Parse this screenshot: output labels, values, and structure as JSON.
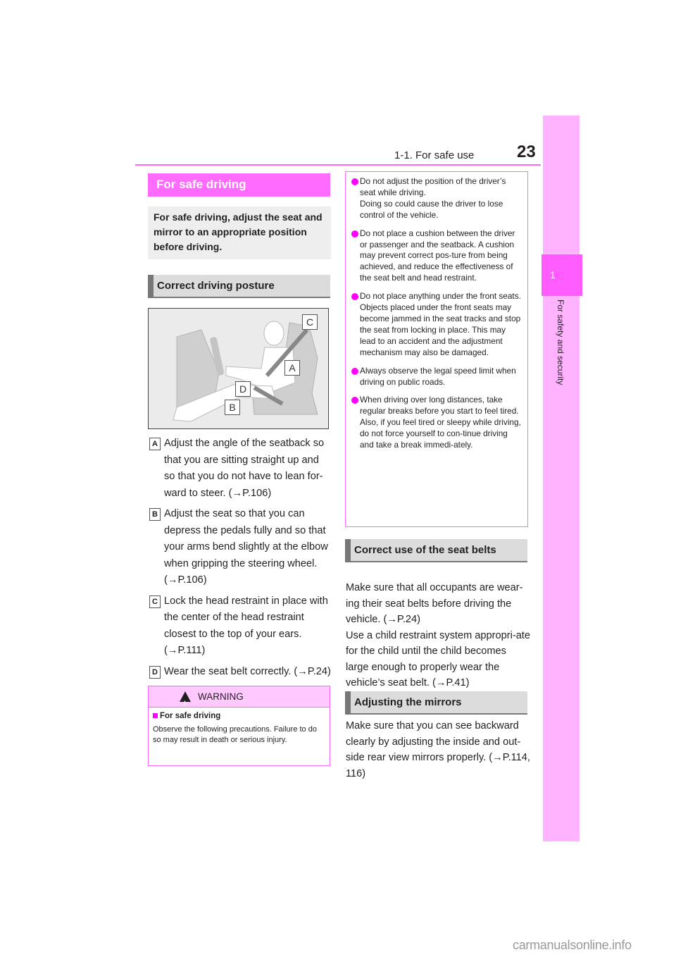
{
  "header": {
    "section": "1-1. For safe use",
    "page_number": "23"
  },
  "side_tab": {
    "chapter_number": "1",
    "chapter_title": "For safety and security"
  },
  "title": "For safe driving",
  "intro": "For safe driving, adjust the seat and mirror to an appropriate position before driving.",
  "posture": {
    "heading": "Correct driving posture",
    "figure_callouts": [
      "C",
      "A",
      "D",
      "B"
    ],
    "steps": [
      {
        "label": "A",
        "text": "Adjust the angle of the seatback so that you are sitting straight up and so that you do not have to lean for-ward to steer. (→P.106)"
      },
      {
        "label": "B",
        "text": "Adjust the seat so that you can depress the pedals fully and so that your arms bend slightly at the elbow when gripping the steering wheel. (→P.106)"
      },
      {
        "label": "C",
        "text": "Lock the head restraint in place with the center of the head restraint closest to the top of your ears. (→P.111)"
      },
      {
        "label": "D",
        "text": "Wear the seat belt correctly. (→P.24)"
      }
    ]
  },
  "warning": {
    "heading": "WARNING",
    "subheading": "For safe driving",
    "text": "Observe the following precautions. Failure to do so may result in death or serious injury.",
    "bullets": [
      {
        "lines": [
          "Do not adjust the position of the driver’s seat while driving.",
          "Doing so could cause the driver to lose control of the vehicle."
        ]
      },
      {
        "lines": [
          "Do not place a cushion between the driver or passenger and the seatback. A cushion may prevent correct pos-ture from being achieved, and reduce the effectiveness of the seat belt and head restraint."
        ]
      },
      {
        "lines": [
          "Do not place anything under the front seats.",
          "Objects placed under the front seats may become jammed in the seat tracks and stop the seat from locking in place. This may lead to an accident and the adjustment mechanism may also be damaged."
        ]
      },
      {
        "lines": [
          "Always observe the legal speed limit when driving on public roads."
        ]
      },
      {
        "lines": [
          "When driving over long distances, take regular breaks before you start to feel tired.",
          "Also, if you feel tired or sleepy while driving, do not force yourself to con-tinue driving and take a break immedi-ately."
        ]
      }
    ]
  },
  "seat_belts": {
    "heading": "Correct use of the seat belts",
    "paragraphs": [
      "Make sure that all occupants are wear-ing their seat belts before driving the vehicle. (→P.24)",
      "Use a child restraint system appropri-ate for the child until the child becomes large enough to properly wear the vehicle’s seat belt. (→P.41)"
    ]
  },
  "mirrors": {
    "heading": "Adjusting the mirrors",
    "paragraphs": [
      "Make sure that you can see backward clearly by adjusting the inside and out-side rear view mirrors properly. (→P.114, 116)"
    ]
  },
  "watermark": "carmanualsonline.info",
  "colors": {
    "accent": "#ff66ff",
    "accent_light": "#ffb3ff",
    "bullet": "#ff00ff"
  }
}
